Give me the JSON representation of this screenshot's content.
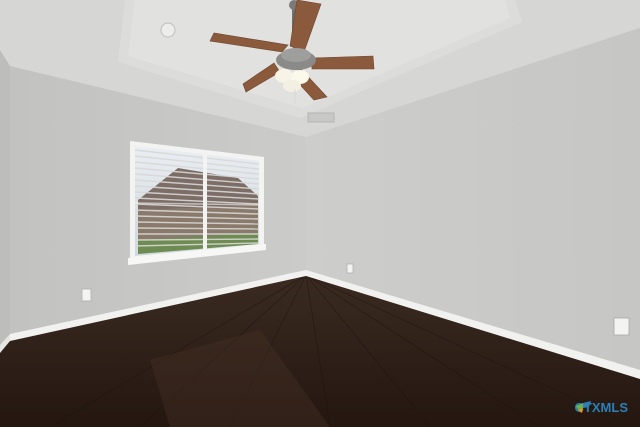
{
  "photo": {
    "subject": "empty-room-with-ceiling-fan",
    "colors": {
      "wall_left": "#c9c9c7",
      "wall_right": "#cdcdcb",
      "ceiling": "#d8d8d6",
      "tray_ceiling": "#dedede",
      "floor_dark": "#2b1d16",
      "floor_mid": "#3a2820",
      "baseboard": "#f2f2f0",
      "fan_blade": "#8b5a3c"
    }
  },
  "watermark": {
    "text": "CTXMLS",
    "colors": {
      "ctx": "#2c7fb8",
      "mls": "#2c7fb8",
      "leaf_green": "#6ab04c",
      "leaf_blue": "#2c7fb8",
      "leaf_orange": "#f39c12"
    }
  }
}
